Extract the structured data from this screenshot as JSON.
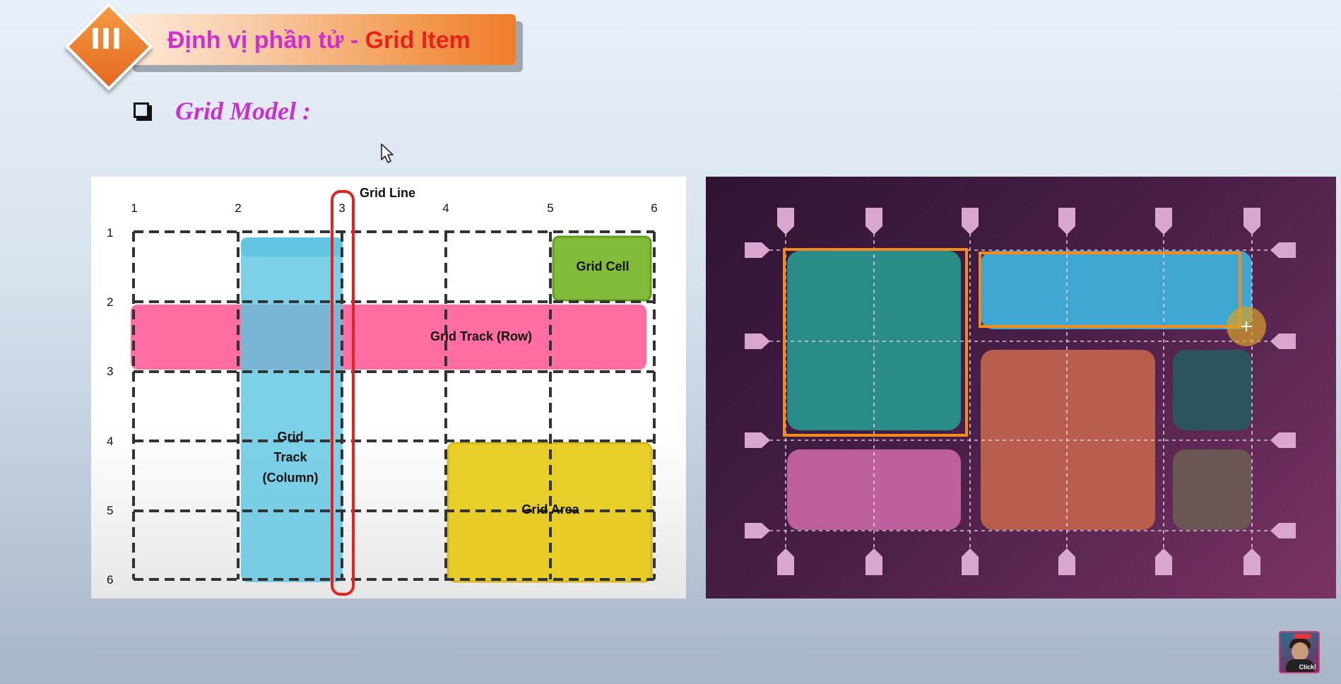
{
  "header": {
    "badge_numeral": "III",
    "title_part1": "Định vị phần tử - ",
    "title_part2": "Grid Item",
    "title_color_1": "#cf2fcf",
    "title_color_2": "#e8231b"
  },
  "subtitle": {
    "icon": "checkbox-icon",
    "text": "Grid Model :"
  },
  "left_diagram": {
    "grid_line_label": "Grid Line",
    "column_numbers": [
      "1",
      "2",
      "3",
      "4",
      "5",
      "6"
    ],
    "row_numbers": [
      "1",
      "2",
      "3",
      "4",
      "5",
      "6"
    ],
    "grid_cell_label": "Grid Cell",
    "grid_track_row_label": "Grid Track (Row)",
    "grid_track_column_label_lines": [
      "Grid",
      "Track",
      "(Column)"
    ],
    "grid_area_label": "Grid Area",
    "colors": {
      "grid_cell": "#7cb82f",
      "grid_track_row": "#ff5d98",
      "grid_track_column": "#5ec4e0",
      "grid_area": "#e8cc1e",
      "grid_line_highlight": "#e32222"
    }
  },
  "right_diagram": {
    "colors": {
      "teal": "#2a8c88",
      "blue": "#3fa6d1",
      "coral": "#b95e4d",
      "dark_teal": "#2b5360",
      "pink": "#bd5f9c",
      "taupe": "#6b5656",
      "selection": "#f28c1e",
      "markers": "#d9a6d2"
    }
  },
  "avatar": {
    "label": "Click!"
  }
}
